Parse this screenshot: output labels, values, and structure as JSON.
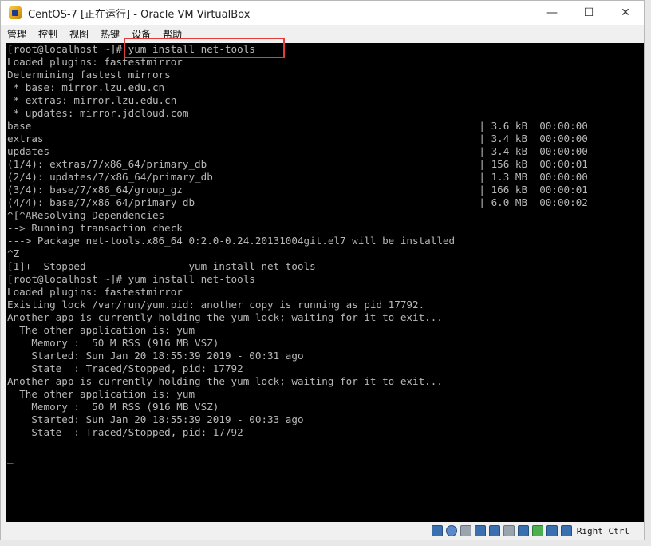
{
  "window": {
    "title": "CentOS-7 [正在运行] - Oracle VM VirtualBox",
    "controls": {
      "minimize": "—",
      "maximize": "☐",
      "close": "✕"
    }
  },
  "menubar": {
    "items": [
      "管理",
      "控制",
      "视图",
      "热键",
      "设备",
      "帮助"
    ]
  },
  "terminal": {
    "lines": [
      "[root@localhost ~]# yum install net-tools",
      "Loaded plugins: fastestmirror",
      "Determining fastest mirrors",
      " * base: mirror.lzu.edu.cn",
      " * extras: mirror.lzu.edu.cn",
      " * updates: mirror.jdcloud.com",
      "base                                                                          | 3.6 kB  00:00:00",
      "extras                                                                        | 3.4 kB  00:00:00",
      "updates                                                                       | 3.4 kB  00:00:00",
      "(1/4): extras/7/x86_64/primary_db                                             | 156 kB  00:00:01",
      "(2/4): updates/7/x86_64/primary_db                                            | 1.3 MB  00:00:00",
      "(3/4): base/7/x86_64/group_gz                                                 | 166 kB  00:00:01",
      "(4/4): base/7/x86_64/primary_db                                               | 6.0 MB  00:00:02",
      "^[^AResolving Dependencies",
      "--> Running transaction check",
      "---> Package net-tools.x86_64 0:2.0-0.24.20131004git.el7 will be installed",
      "^Z",
      "[1]+  Stopped                 yum install net-tools",
      "[root@localhost ~]# yum install net-tools",
      "Loaded plugins: fastestmirror",
      "Existing lock /var/run/yum.pid: another copy is running as pid 17792.",
      "Another app is currently holding the yum lock; waiting for it to exit...",
      "  The other application is: yum",
      "    Memory :  50 M RSS (916 MB VSZ)",
      "    Started: Sun Jan 20 18:55:39 2019 - 00:31 ago",
      "    State  : Traced/Stopped, pid: 17792",
      "Another app is currently holding the yum lock; waiting for it to exit...",
      "  The other application is: yum",
      "    Memory :  50 M RSS (916 MB VSZ)",
      "    Started: Sun Jan 20 18:55:39 2019 - 00:33 ago",
      "    State  : Traced/Stopped, pid: 17792",
      "",
      "_"
    ]
  },
  "statusbar": {
    "icons": [
      "hard-disk-icon",
      "optical-drive-icon",
      "audio-icon",
      "network-icon",
      "usb-icon",
      "shared-folders-icon",
      "display-icon",
      "video-capture-icon",
      "cpu-icon",
      "mouse-integration-icon"
    ],
    "host_key": "Right Ctrl"
  },
  "colors": {
    "terminal_bg": "#000000",
    "terminal_fg": "#b8b8b8",
    "highlight": "#e63b3b"
  }
}
